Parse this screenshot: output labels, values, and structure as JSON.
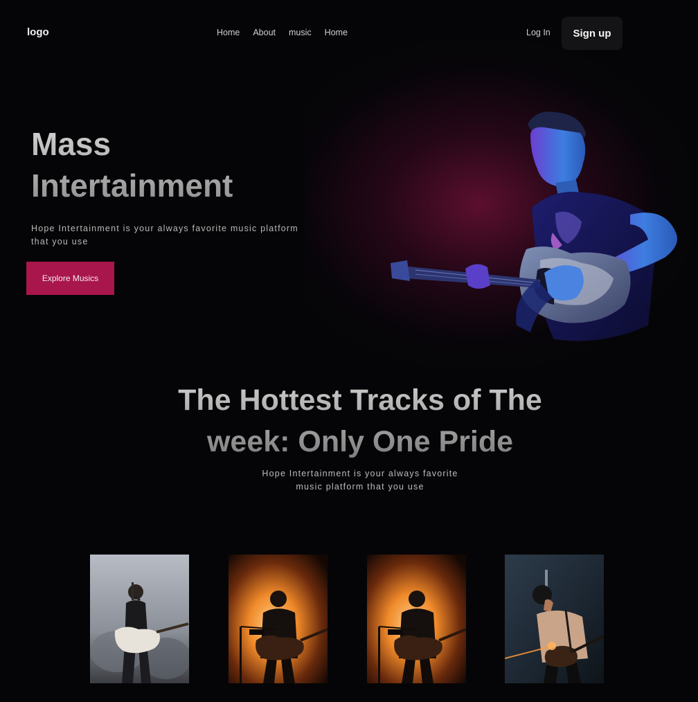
{
  "nav": {
    "logo": "logo",
    "links": [
      "Home",
      "About",
      "music",
      "Home"
    ],
    "login": "Log In",
    "signup": "Sign up"
  },
  "hero": {
    "title_line1": "Mass",
    "title_line2": "Intertainment",
    "subtitle": "Hope Intertainment is your always favorite music platform that you use",
    "cta": "Explore Musics",
    "image_icon": "guitarist-photo"
  },
  "section": {
    "title_line1": "The Hottest Tracks of The",
    "title_line2": "week: Only One Pride",
    "subtitle_line1": "Hope Intertainment is your always favorite",
    "subtitle_line2": "music platform that you use"
  },
  "tracks": [
    {
      "icon": "female-guitarist-photo"
    },
    {
      "icon": "stage-guitarist-photo"
    },
    {
      "icon": "stage-guitarist-photo"
    },
    {
      "icon": "studio-guitarist-photo"
    }
  ],
  "colors": {
    "background": "#050507",
    "accent": "#a8164c",
    "glow": "#78123c",
    "signup_bg": "#141416"
  }
}
